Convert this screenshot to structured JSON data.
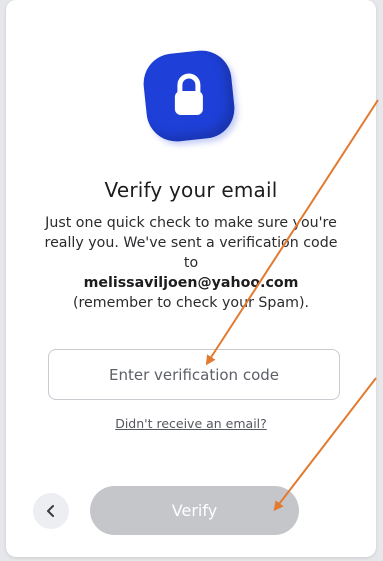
{
  "verify": {
    "title": "Verify your email",
    "description_part1": "Just one quick check to make sure you're really you. We've sent a verification code to",
    "email": "melissaviljoen@yahoo.com",
    "description_part2": "(remember to check your Spam).",
    "code_placeholder": "Enter verification code",
    "code_value": "",
    "resend_link": "Didn't receive an email?",
    "verify_label": "Verify",
    "back_icon": "chevron-left-icon",
    "lock_icon": "lock-icon"
  },
  "colors": {
    "accent": "#1e40d8",
    "button_disabled": "#c4c6ca",
    "annotation_arrow": "#e27a2f"
  }
}
